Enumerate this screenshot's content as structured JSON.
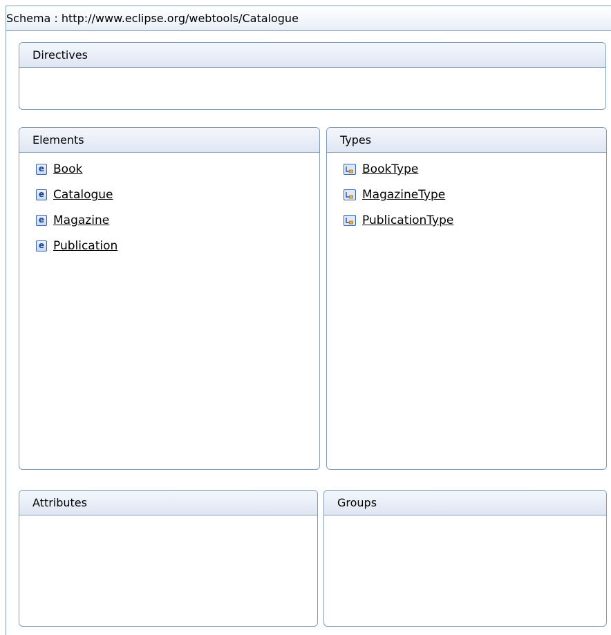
{
  "schema": {
    "header": "Schema : http://www.eclipse.org/webtools/Catalogue"
  },
  "sections": {
    "directives": {
      "title": "Directives"
    },
    "elements": {
      "title": "Elements",
      "items": [
        {
          "label": "Book",
          "icon": "element-icon"
        },
        {
          "label": "Catalogue",
          "icon": "element-icon"
        },
        {
          "label": "Magazine",
          "icon": "element-icon"
        },
        {
          "label": "Publication",
          "icon": "element-icon"
        }
      ]
    },
    "types": {
      "title": "Types",
      "items": [
        {
          "label": "BookType",
          "icon": "complex-type-icon"
        },
        {
          "label": "MagazineType",
          "icon": "complex-type-icon"
        },
        {
          "label": "PublicationType",
          "icon": "complex-type-icon"
        }
      ]
    },
    "attributes": {
      "title": "Attributes"
    },
    "groups": {
      "title": "Groups"
    }
  },
  "colors": {
    "border": "#7f9db9",
    "title_bar": "#dfe6f3"
  }
}
